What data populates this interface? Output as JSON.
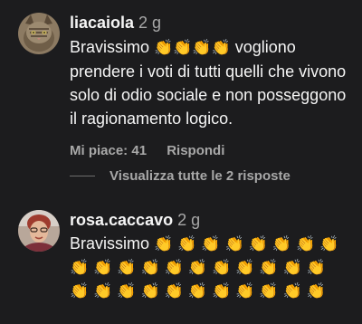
{
  "comments": [
    {
      "username": "liacaiola",
      "time": "2 g",
      "text_lead": "Bravissimo",
      "emoji": "👏👏👏👏",
      "text_tail": " vogliono prendere i voti di tutti quelli che vivono solo di odio sociale e non posseggono il ragionamento logico.",
      "likes": "Mi piace: 41",
      "reply": "Rispondi",
      "avatar_icon": "cat-photo"
    },
    {
      "username": "rosa.caccavo",
      "time": "2 g",
      "text_lead": "Bravissimo",
      "emoji": "👏👏👏👏👏👏👏👏👏👏👏👏👏👏👏👏👏👏👏👏👏👏👏👏👏👏👏👏👏👏",
      "avatar_icon": "person-photo"
    }
  ],
  "view_replies": "Visualizza tutte le 2 risposte",
  "colors": {
    "background": "#1c1c1e",
    "text": "#f5f5f5",
    "muted": "#a8a8a8",
    "clap": "#f3c23a"
  }
}
